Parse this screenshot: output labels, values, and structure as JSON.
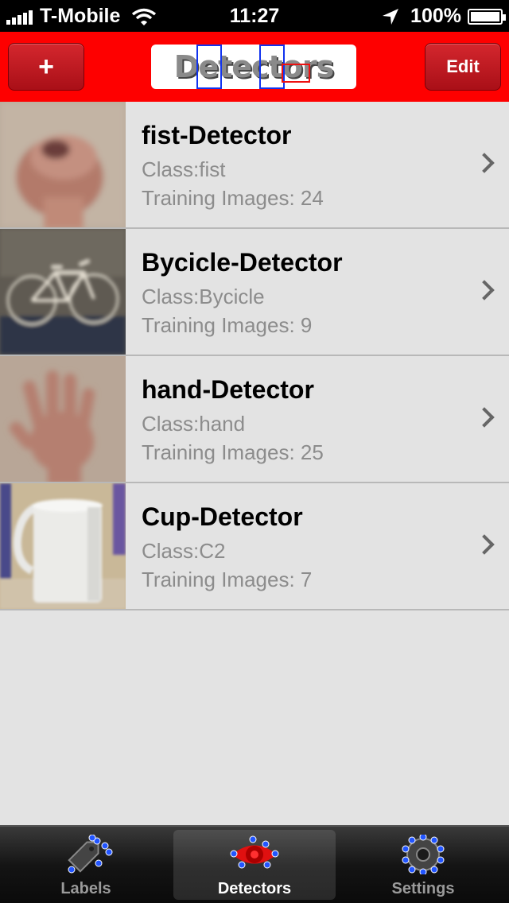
{
  "status_bar": {
    "carrier": "T-Mobile",
    "time": "11:27",
    "battery": "100%"
  },
  "nav": {
    "add_label": "+",
    "title": "Detectors",
    "edit_label": "Edit"
  },
  "detectors": [
    {
      "title": "fist-Detector",
      "class_text": "Class:fist",
      "training_text": "Training Images: 24",
      "thumbnail": "blurry fist"
    },
    {
      "title": "Bycicle-Detector",
      "class_text": "Class:Bycicle",
      "training_text": "Training Images: 9",
      "thumbnail": "blurry bicycle"
    },
    {
      "title": "hand-Detector",
      "class_text": "Class:hand",
      "training_text": "Training Images: 25",
      "thumbnail": "blurry open hand"
    },
    {
      "title": "Cup-Detector",
      "class_text": "Class:C2",
      "training_text": "Training Images: 7",
      "thumbnail": "white cup"
    }
  ],
  "tabs": [
    {
      "label": "Labels",
      "icon": "tag-icon",
      "active": false
    },
    {
      "label": "Detectors",
      "icon": "eye-icon",
      "active": true
    },
    {
      "label": "Settings",
      "icon": "gear-icon",
      "active": false
    }
  ],
  "colors": {
    "nav_background": "#fe0000",
    "nav_button": "#b51820",
    "list_background": "#e3e3e3",
    "icon_dots": "#2255ff"
  }
}
